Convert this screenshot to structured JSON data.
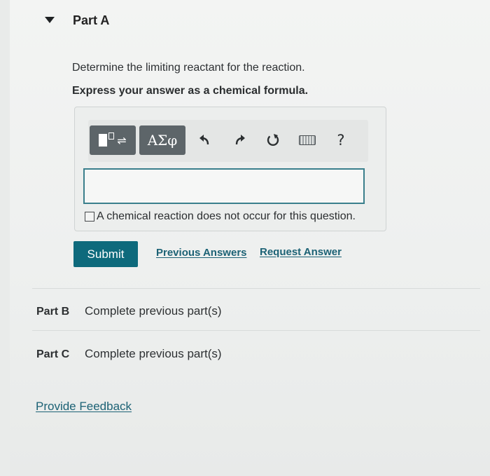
{
  "part_a": {
    "title": "Part A",
    "prompt": "Determine the limiting reactant for the reaction.",
    "instruction": "Express your answer as a chemical formula.",
    "toolbar": {
      "templates_icon": "template-arrows-icon",
      "symbols_label": "ΑΣφ",
      "undo_icon": "undo-icon",
      "redo_icon": "redo-icon",
      "reset_icon": "reset-icon",
      "keyboard_icon": "keyboard-icon",
      "help_label": "?"
    },
    "answer_value": "",
    "no_reaction_checkbox_label": "A chemical reaction does not occur for this question.",
    "no_reaction_checked": false,
    "submit_label": "Submit",
    "previous_answers_label": "Previous Answers",
    "request_answer_label": "Request Answer"
  },
  "part_b": {
    "label": "Part B",
    "status": "Complete previous part(s)"
  },
  "part_c": {
    "label": "Part C",
    "status": "Complete previous part(s)"
  },
  "feedback_label": "Provide Feedback",
  "colors": {
    "submit_bg": "#0e6a7c",
    "link": "#1c6275",
    "input_border": "#3a7f8c",
    "toolbar_button": "#5d6569"
  }
}
